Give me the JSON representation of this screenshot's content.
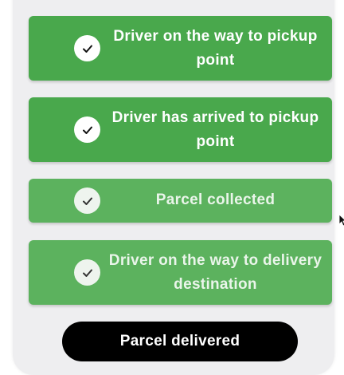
{
  "steps": [
    {
      "label": "Driver on the way to pickup point",
      "state": "done"
    },
    {
      "label": "Driver has arrived to pickup point",
      "state": "done"
    },
    {
      "label": "Parcel collected",
      "state": "done"
    },
    {
      "label": "Driver on the way to delivery destination",
      "state": "done"
    }
  ],
  "final_button": {
    "label": "Parcel delivered"
  },
  "colors": {
    "step_green": "#49a84c",
    "button_black": "#000000",
    "panel_bg": "#eeeef0"
  },
  "icons": {
    "step_status": "checkmark-icon",
    "pointer": "mouse-cursor-icon"
  }
}
